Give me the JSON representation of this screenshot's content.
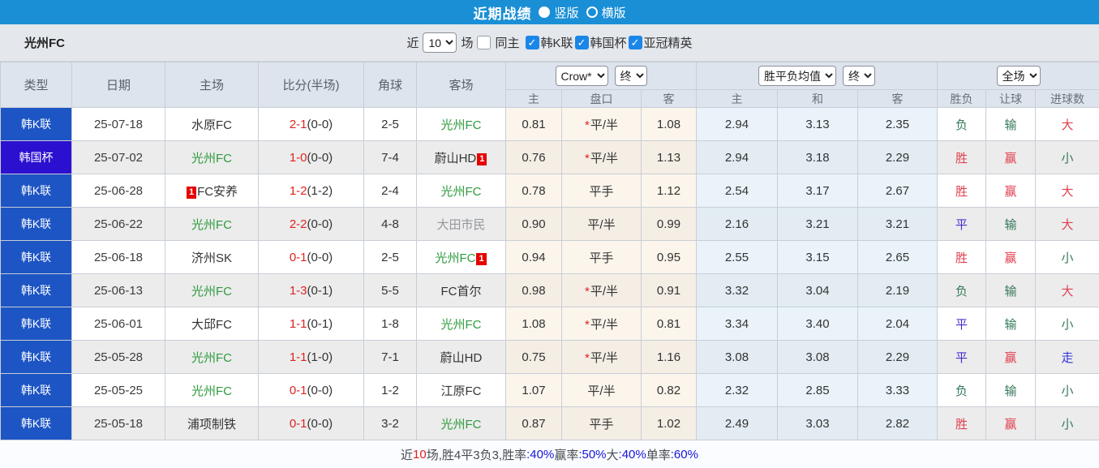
{
  "colors": {
    "topbar": "#1a8fd6",
    "league_badge": "#1d55c4",
    "cup_badge": "#2b10d0",
    "team_green": "#2e9b3e",
    "score_red": "#e02222",
    "result_red": "#e0404f",
    "result_green": "#35795a",
    "result_purple": "#4a2ad0",
    "result_blue": "#3333dd",
    "footer_blue": "#1515dd"
  },
  "titlebar": {
    "title": "近期战绩",
    "radio_vertical": "竖版",
    "radio_horizontal": "横版",
    "selected": "竖版"
  },
  "filters": {
    "team": "光州FC",
    "near_label": "近",
    "count_value": "10",
    "games_label": "场",
    "same_home_label": "同主",
    "same_home_checked": false,
    "leagues": [
      {
        "label": "韩K联",
        "checked": true
      },
      {
        "label": "韩国杯",
        "checked": true
      },
      {
        "label": "亚冠精英",
        "checked": true
      }
    ]
  },
  "table": {
    "headers": {
      "type": "类型",
      "date": "日期",
      "home": "主场",
      "score": "比分(半场)",
      "corners": "角球",
      "away": "客场"
    },
    "dropdowns": {
      "bookmaker": "Crow*",
      "odds_time": "终",
      "avg": "胜平负均值",
      "avg_time": "终",
      "scope": "全场"
    },
    "sub_headers": [
      "主",
      "盘口",
      "客",
      "主",
      "和",
      "客",
      "胜负",
      "让球",
      "进球数"
    ],
    "rows": [
      {
        "type": "韩K联",
        "cup": false,
        "date": "25-07-18",
        "home": {
          "name": "水原FC"
        },
        "score": "2-1",
        "half": "(0-0)",
        "corners": "2-5",
        "away": {
          "name": "光州FC",
          "green": true
        },
        "crow": {
          "home": "0.81",
          "star": true,
          "handicap": "平/半",
          "away": "1.08"
        },
        "avg": {
          "home": "2.94",
          "draw": "3.13",
          "away": "2.35"
        },
        "result": {
          "outcome": "负",
          "spread": "输",
          "goals": "大"
        }
      },
      {
        "type": "韩国杯",
        "cup": true,
        "date": "25-07-02",
        "home": {
          "name": "光州FC",
          "green": true
        },
        "score": "1-0",
        "half": "(0-0)",
        "corners": "7-4",
        "away": {
          "name": "蔚山HD",
          "badge": "1",
          "badge_pos": "after"
        },
        "crow": {
          "home": "0.76",
          "star": true,
          "handicap": "平/半",
          "away": "1.13"
        },
        "avg": {
          "home": "2.94",
          "draw": "3.18",
          "away": "2.29"
        },
        "result": {
          "outcome": "胜",
          "spread": "赢",
          "goals": "小"
        }
      },
      {
        "type": "韩K联",
        "cup": false,
        "date": "25-06-28",
        "home": {
          "name": "FC安养",
          "badge": "1",
          "badge_pos": "before"
        },
        "score": "1-2",
        "half": "(1-2)",
        "corners": "2-4",
        "away": {
          "name": "光州FC",
          "green": true
        },
        "crow": {
          "home": "0.78",
          "star": false,
          "handicap": "平手",
          "away": "1.12"
        },
        "avg": {
          "home": "2.54",
          "draw": "3.17",
          "away": "2.67"
        },
        "result": {
          "outcome": "胜",
          "spread": "赢",
          "goals": "大"
        }
      },
      {
        "type": "韩K联",
        "cup": false,
        "date": "25-06-22",
        "home": {
          "name": "光州FC",
          "green": true
        },
        "score": "2-2",
        "half": "(0-0)",
        "corners": "4-8",
        "away": {
          "name": "大田市民",
          "dim": true
        },
        "crow": {
          "home": "0.90",
          "star": false,
          "handicap": "平/半",
          "away": "0.99"
        },
        "avg": {
          "home": "2.16",
          "draw": "3.21",
          "away": "3.21"
        },
        "result": {
          "outcome": "平",
          "spread": "输",
          "goals": "大"
        }
      },
      {
        "type": "韩K联",
        "cup": false,
        "date": "25-06-18",
        "home": {
          "name": "济州SK"
        },
        "score": "0-1",
        "half": "(0-0)",
        "corners": "2-5",
        "away": {
          "name": "光州FC",
          "green": true,
          "badge": "1",
          "badge_pos": "after"
        },
        "crow": {
          "home": "0.94",
          "star": false,
          "handicap": "平手",
          "away": "0.95"
        },
        "avg": {
          "home": "2.55",
          "draw": "3.15",
          "away": "2.65"
        },
        "result": {
          "outcome": "胜",
          "spread": "赢",
          "goals": "小"
        }
      },
      {
        "type": "韩K联",
        "cup": false,
        "date": "25-06-13",
        "home": {
          "name": "光州FC",
          "green": true
        },
        "score": "1-3",
        "half": "(0-1)",
        "corners": "5-5",
        "away": {
          "name": "FC首尔"
        },
        "crow": {
          "home": "0.98",
          "star": true,
          "handicap": "平/半",
          "away": "0.91"
        },
        "avg": {
          "home": "3.32",
          "draw": "3.04",
          "away": "2.19"
        },
        "result": {
          "outcome": "负",
          "spread": "输",
          "goals": "大"
        }
      },
      {
        "type": "韩K联",
        "cup": false,
        "date": "25-06-01",
        "home": {
          "name": "大邱FC"
        },
        "score": "1-1",
        "half": "(0-1)",
        "corners": "1-8",
        "away": {
          "name": "光州FC",
          "green": true
        },
        "crow": {
          "home": "1.08",
          "star": true,
          "handicap": "平/半",
          "away": "0.81"
        },
        "avg": {
          "home": "3.34",
          "draw": "3.40",
          "away": "2.04"
        },
        "result": {
          "outcome": "平",
          "spread": "输",
          "goals": "小"
        }
      },
      {
        "type": "韩K联",
        "cup": false,
        "date": "25-05-28",
        "home": {
          "name": "光州FC",
          "green": true
        },
        "score": "1-1",
        "half": "(1-0)",
        "corners": "7-1",
        "away": {
          "name": "蔚山HD"
        },
        "crow": {
          "home": "0.75",
          "star": true,
          "handicap": "平/半",
          "away": "1.16"
        },
        "avg": {
          "home": "3.08",
          "draw": "3.08",
          "away": "2.29"
        },
        "result": {
          "outcome": "平",
          "spread": "赢",
          "goals": "走"
        }
      },
      {
        "type": "韩K联",
        "cup": false,
        "date": "25-05-25",
        "home": {
          "name": "光州FC",
          "green": true
        },
        "score": "0-1",
        "half": "(0-0)",
        "corners": "1-2",
        "away": {
          "name": "江原FC"
        },
        "crow": {
          "home": "1.07",
          "star": false,
          "handicap": "平/半",
          "away": "0.82"
        },
        "avg": {
          "home": "2.32",
          "draw": "2.85",
          "away": "3.33"
        },
        "result": {
          "outcome": "负",
          "spread": "输",
          "goals": "小"
        }
      },
      {
        "type": "韩K联",
        "cup": false,
        "date": "25-05-18",
        "home": {
          "name": "浦项制铁"
        },
        "score": "0-1",
        "half": "(0-0)",
        "corners": "3-2",
        "away": {
          "name": "光州FC",
          "green": true
        },
        "crow": {
          "home": "0.87",
          "star": false,
          "handicap": "平手",
          "away": "1.02"
        },
        "avg": {
          "home": "2.49",
          "draw": "3.03",
          "away": "2.82"
        },
        "result": {
          "outcome": "胜",
          "spread": "赢",
          "goals": "小"
        }
      }
    ]
  },
  "footer": {
    "segments": [
      {
        "text": "近",
        "color": "dark"
      },
      {
        "text": "10",
        "color": "red"
      },
      {
        "text": "场,胜4平3负3, ",
        "color": "dark"
      },
      {
        "text": "胜率",
        "color": "dark"
      },
      {
        "text": ":40%",
        "color": "blue"
      },
      {
        "text": " 赢率",
        "color": "dark"
      },
      {
        "text": ":50%",
        "color": "blue"
      },
      {
        "text": " 大",
        "color": "dark"
      },
      {
        "text": ":40%",
        "color": "blue"
      },
      {
        "text": " 单率",
        "color": "dark"
      },
      {
        "text": ":60%",
        "color": "blue"
      }
    ]
  }
}
